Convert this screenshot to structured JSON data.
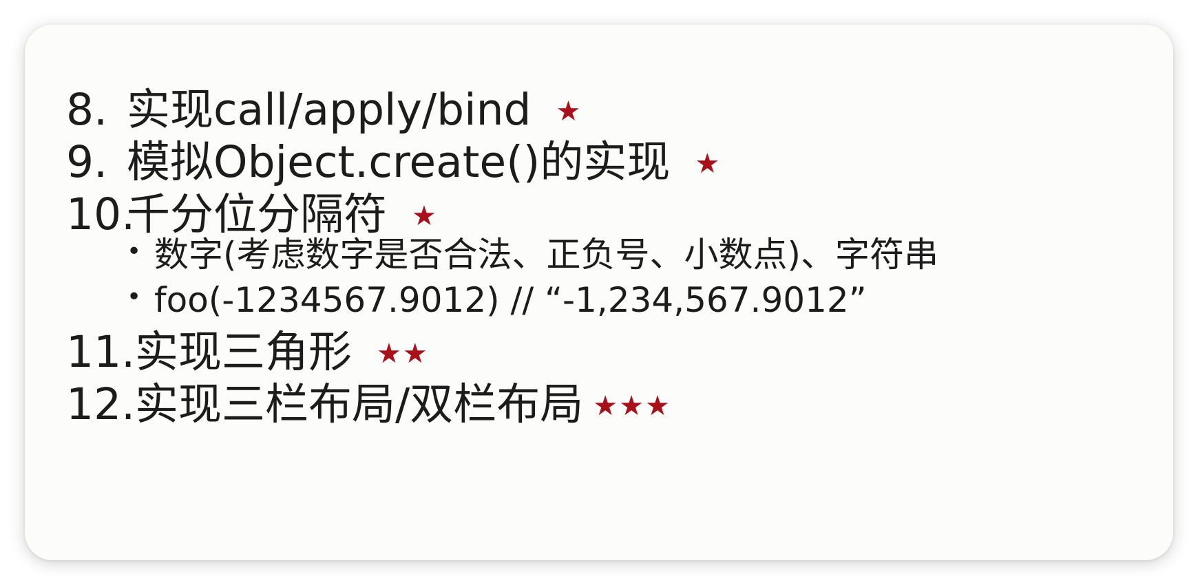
{
  "items": [
    {
      "number": "8.",
      "text": "实现call/apply/bind",
      "stars": "★"
    },
    {
      "number": "9.",
      "text": "模拟Object.create()的实现",
      "stars": "★"
    },
    {
      "number": "10.",
      "text": "千分位分隔符",
      "stars": "★",
      "bullets": [
        {
          "symbol": "•",
          "text": "数字(考虑数字是否合法、正负号、小数点)、字符串"
        },
        {
          "symbol": "•",
          "text": "foo(-1234567.9012) // “-1,234,567.9012”"
        }
      ]
    },
    {
      "number": "11.",
      "text": "实现三角形",
      "stars": "★★"
    },
    {
      "number": "12.",
      "text": "实现三栏布局/双栏布局",
      "stars": "★★★"
    }
  ],
  "colors": {
    "star": "#a8101a",
    "text": "#1c1c1c",
    "card_background": "#fcfcfa"
  }
}
